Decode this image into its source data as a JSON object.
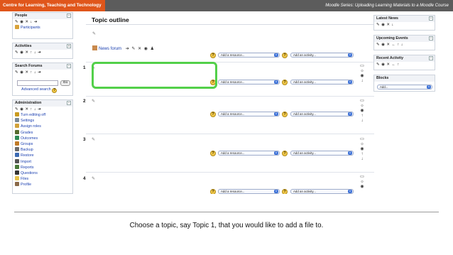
{
  "header": {
    "left_label": "Centre for Learning, Teaching and Technology",
    "right_label": "Moodle Series: Uploading Learning Materials to a Moodle Course"
  },
  "colors": {
    "header_accent": "#e0561b",
    "header_bar": "#5c5c5c",
    "highlight": "#53d04a",
    "select_arrow": "#3f73d8"
  },
  "left_blocks": {
    "people": {
      "title": "People",
      "controls": "✎ ◉ ✕ ↓ ➔",
      "items": [
        {
          "label": "Participants",
          "icon": "participants-icon"
        }
      ]
    },
    "activities": {
      "title": "Activities",
      "controls": "✎ ◉ ✕ ↑ ↓ ➔"
    },
    "search": {
      "title": "Search Forums",
      "controls": "✎ ◉ ✕ ↑ ↓ ➔",
      "go": "Go",
      "advanced": "Advanced search"
    },
    "administration": {
      "title": "Administration",
      "controls": "✎ ◉ ✕ ↑ ↓ ➔",
      "items": [
        {
          "label": "Turn editing off",
          "icon": "edit-icon",
          "color": "#c99a1e"
        },
        {
          "label": "Settings",
          "icon": "settings-icon",
          "color": "#7a8a99"
        },
        {
          "label": "Assign roles",
          "icon": "roles-icon",
          "color": "#d2a23a"
        },
        {
          "label": "Grades",
          "icon": "grades-icon",
          "color": "#556b2f"
        },
        {
          "label": "Outcomes",
          "icon": "outcomes-icon",
          "color": "#2e8b57"
        },
        {
          "label": "Groups",
          "icon": "groups-icon",
          "color": "#c07a27"
        },
        {
          "label": "Backup",
          "icon": "backup-icon",
          "color": "#6b6b6b"
        },
        {
          "label": "Restore",
          "icon": "restore-icon",
          "color": "#3d6bb3"
        },
        {
          "label": "Import",
          "icon": "import-icon",
          "color": "#555555"
        },
        {
          "label": "Reports",
          "icon": "reports-icon",
          "color": "#4a7a3a"
        },
        {
          "label": "Questions",
          "icon": "questions-icon",
          "color": "#333333"
        },
        {
          "label": "Files",
          "icon": "files-icon",
          "color": "#e6c14a"
        },
        {
          "label": "Profile",
          "icon": "profile-icon",
          "color": "#8a6a4a"
        }
      ]
    }
  },
  "main": {
    "title": "Topic outline",
    "topic0": {
      "forum_label": "News forum",
      "forum_controls": "➔ ✎ ✕ ◉ ♟"
    },
    "add_resource": "Add a resource...",
    "add_activity": "Add an activity...",
    "topics": [
      "1",
      "2",
      "3",
      "4"
    ]
  },
  "right_blocks": {
    "latest_news": {
      "title": "Latest News",
      "controls": "✎ ◉ ✕ ↓"
    },
    "upcoming_events": {
      "title": "Upcoming Events",
      "controls": "✎ ◉ ✕ ← ↑ ↓"
    },
    "recent_activity": {
      "title": "Recent Activity",
      "controls": "✎ ◉ ✕ ← ↑"
    },
    "blocks": {
      "title": "Blocks",
      "select_label": "Add..."
    }
  },
  "caption": "Choose a topic, say Topic 1, that you would like to add a file to."
}
